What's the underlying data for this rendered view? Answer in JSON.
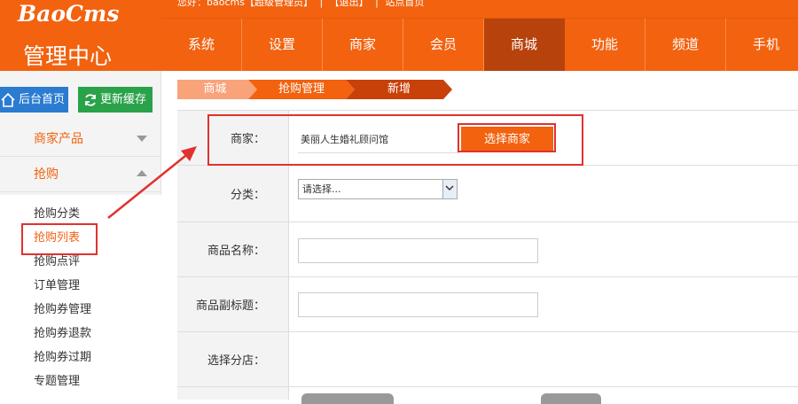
{
  "header": {
    "logo_text": "BaoCms",
    "logo_sub": "管理中心",
    "welcome": [
      "您好：baocms【超级管理员】",
      "|",
      "【退出】",
      "|",
      "站点首页"
    ],
    "nav": [
      "系统",
      "设置",
      "商家",
      "会员",
      "商城",
      "功能",
      "频道",
      "手机"
    ],
    "active_nav": "商城"
  },
  "sidebar": {
    "home_button": "后台首页",
    "cache_button": "更新缓存",
    "groups": [
      "商家产品",
      "抢购"
    ],
    "items": [
      "抢购分类",
      "抢购列表",
      "抢购点评",
      "订单管理",
      "抢购券管理",
      "抢购券退款",
      "抢购券过期",
      "专题管理"
    ],
    "active_item": "抢购列表"
  },
  "breadcrumb": [
    "商城",
    "抢购管理",
    "新增"
  ],
  "form": {
    "merchant_label": "商家：",
    "merchant_value": "美丽人生婚礼顾问馆",
    "select_merchant_button": "选择商家",
    "category_label": "分类：",
    "category_value": "请选择...",
    "product_name_label": "商品名称：",
    "product_name_value": "",
    "product_subtitle_label": "商品副标题：",
    "product_subtitle_value": "",
    "branch_label": "选择分店："
  },
  "colors": {
    "brand": "#f2620f",
    "active_nav": "#b8420b",
    "annotation": "#e0322e",
    "home_button": "#2b7bd1",
    "cache_button": "#2aa24a"
  }
}
